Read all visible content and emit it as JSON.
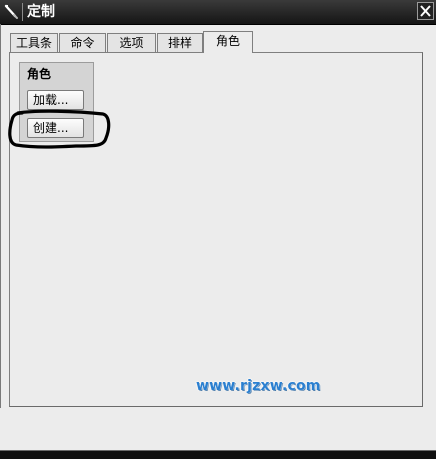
{
  "window": {
    "title": "定制",
    "icon": "tool-wrench-icon",
    "close_icon": "close-icon"
  },
  "tabs": [
    {
      "label": "工具条",
      "active": false
    },
    {
      "label": "命令",
      "active": false
    },
    {
      "label": "选项",
      "active": false
    },
    {
      "label": "排样",
      "active": false
    },
    {
      "label": "角色",
      "active": true
    }
  ],
  "role_group": {
    "title": "角色",
    "load_button": "加载...",
    "create_button": "创建..."
  },
  "watermark": "www.rjzxw.com",
  "colors": {
    "titlebar": "#222222",
    "panel": "#ececec",
    "group": "#d4d4d4",
    "watermark": "#2a7fd0",
    "annotation": "#000000"
  }
}
